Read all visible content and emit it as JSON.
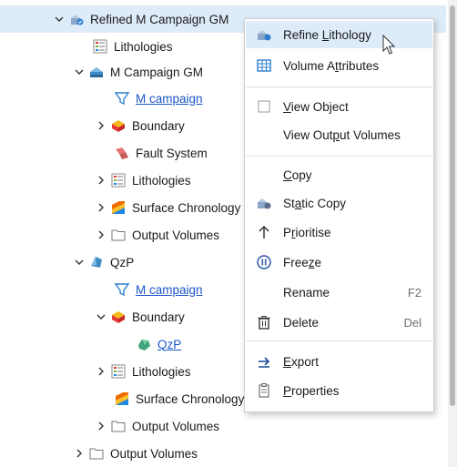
{
  "tree": {
    "root_label": "Refined M Campaign GM",
    "root_lithologies": "Lithologies",
    "m_campaign_gm": "M Campaign GM",
    "m_campaign_link": "M campaign",
    "boundary": "Boundary",
    "fault_system": "Fault System",
    "lithologies": "Lithologies",
    "surface_chronology": "Surface Chronology",
    "output_volumes": "Output Volumes",
    "qzp": "QzP",
    "qzp_m_campaign_link": "M campaign",
    "qzp_boundary": "Boundary",
    "qzp_boundary_item": "QzP",
    "qzp_lithologies": "Lithologies",
    "qzp_surface_chronology": "Surface Chronology",
    "qzp_output_volumes": "Output Volumes",
    "root_output_volumes": "Output Volumes"
  },
  "menu": {
    "refine_lithology": {
      "pre": "Refine ",
      "u": "L",
      "post": "ithology"
    },
    "volume_attributes": {
      "pre": "Volume A",
      "u": "t",
      "post": "tributes"
    },
    "view_object": {
      "pre": "",
      "u": "V",
      "post": "iew Object"
    },
    "view_output_volumes": {
      "pre": "View Out",
      "u": "p",
      "post": "ut Volumes"
    },
    "copy": {
      "pre": "",
      "u": "C",
      "post": "opy"
    },
    "static_copy": {
      "pre": "St",
      "u": "a",
      "post": "tic Copy"
    },
    "prioritise": {
      "pre": "P",
      "u": "r",
      "post": "ioritise"
    },
    "freeze": {
      "pre": "Free",
      "u": "z",
      "post": "e"
    },
    "rename": {
      "pre": "Rename",
      "u": "",
      "post": ""
    },
    "rename_shortcut": "F2",
    "delete": {
      "pre": "Delete",
      "u": "",
      "post": ""
    },
    "delete_shortcut": "Del",
    "export": {
      "pre": "",
      "u": "E",
      "post": "xport"
    },
    "properties": {
      "pre": "",
      "u": "P",
      "post": "roperties"
    }
  },
  "colors": {
    "selection": "#deecf9",
    "link": "#1a55c8",
    "accent_blue": "#2f7fd1"
  },
  "icons": {
    "refined-gm": "geological-model-refined-icon",
    "lithologies": "lithologies-list-icon",
    "gm": "geological-model-icon",
    "link": "funnel-filter-icon",
    "boundary": "boundary-block-icon",
    "fault": "fault-system-icon",
    "surface": "surface-chronology-icon",
    "folder": "folder-icon",
    "qzp": "volume-icon"
  }
}
